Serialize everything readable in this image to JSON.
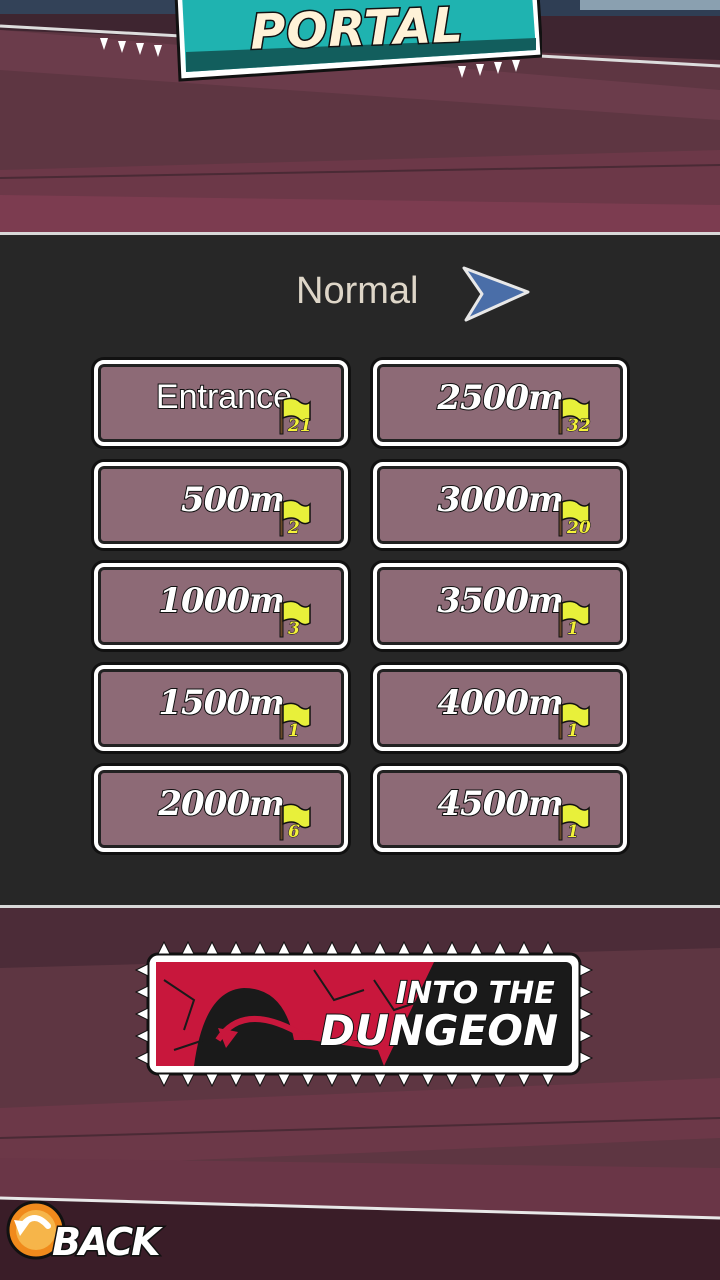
{
  "header": {
    "title": "PORTAL"
  },
  "difficulty": {
    "label": "Normal",
    "arrow_icon": "next-arrow-icon"
  },
  "floors": [
    {
      "label": "Entrance",
      "count": "21"
    },
    {
      "label": "2500m",
      "count": "32"
    },
    {
      "label": "500m",
      "count": "2"
    },
    {
      "label": "3000m",
      "count": "20"
    },
    {
      "label": "1000m",
      "count": "3"
    },
    {
      "label": "3500m",
      "count": "1"
    },
    {
      "label": "1500m",
      "count": "1"
    },
    {
      "label": "4000m",
      "count": "1"
    },
    {
      "label": "2000m",
      "count": "6"
    },
    {
      "label": "4500m",
      "count": "1"
    }
  ],
  "dungeon_button": {
    "line1": "INTO THE",
    "line2": "DUNGEON"
  },
  "back_button": {
    "label": "BACK"
  },
  "colors": {
    "teal": "#1fb3b0",
    "panel": "#272727",
    "button": "#8d6a76",
    "flag": "#e8f03a",
    "accent_red": "#c8173c"
  }
}
